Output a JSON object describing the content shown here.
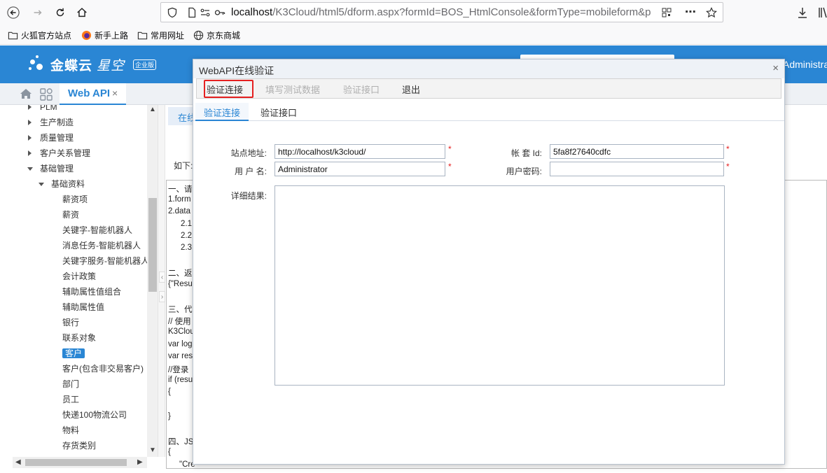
{
  "browser": {
    "url_host": "localhost",
    "url_rest": "/K3Cloud/html5/dform.aspx?formId=BOS_HtmlConsole&formType=mobileform&p",
    "bookmarks": [
      "火狐官方站点",
      "新手上路",
      "常用网址",
      "京东商城"
    ]
  },
  "app": {
    "logo_text": "金蝶云",
    "logo_text2": "星空",
    "logo_badge": "企业版",
    "user": "Administra"
  },
  "tabs": {
    "active": "Web API",
    "close": "×"
  },
  "tree": {
    "items": [
      {
        "label": "PLM",
        "level": 1,
        "arrow": "right"
      },
      {
        "label": "生产制造",
        "level": 1,
        "arrow": "right"
      },
      {
        "label": "质量管理",
        "level": 1,
        "arrow": "right"
      },
      {
        "label": "客户关系管理",
        "level": 1,
        "arrow": "right"
      },
      {
        "label": "基础管理",
        "level": 1,
        "arrow": "down"
      },
      {
        "label": "基础资料",
        "level": 2,
        "arrow": "down"
      },
      {
        "label": "薪资项",
        "level": 3
      },
      {
        "label": "薪资",
        "level": 3
      },
      {
        "label": "关键字-智能机器人",
        "level": 3
      },
      {
        "label": "消息任务-智能机器人",
        "level": 3
      },
      {
        "label": "关键字服务-智能机器人",
        "level": 3
      },
      {
        "label": "会计政策",
        "level": 3
      },
      {
        "label": "辅助属性值组合",
        "level": 3
      },
      {
        "label": "辅助属性值",
        "level": 3
      },
      {
        "label": "银行",
        "level": 3
      },
      {
        "label": "联系对象",
        "level": 3
      },
      {
        "label": "客户",
        "level": 3,
        "selected": true
      },
      {
        "label": "客户(包含非交易客户)",
        "level": 3
      },
      {
        "label": "部门",
        "level": 3
      },
      {
        "label": "员工",
        "level": 3
      },
      {
        "label": "快递100物流公司",
        "level": 3
      },
      {
        "label": "物料",
        "level": 3
      },
      {
        "label": "存货类别",
        "level": 3
      }
    ]
  },
  "doc": {
    "tab_label": "在线",
    "intro": "如下:",
    "lines": [
      "一、请",
      "1.form",
      "2.data",
      "2.1",
      "2.2",
      "2.3",
      "",
      "二、返",
      "{\"Resu",
      "",
      "三、代",
      "// 使用",
      "K3Clou",
      "var log",
      "var res",
      "//登录",
      "if (resu",
      "{",
      "",
      "}",
      "",
      "四、JS",
      "{",
      "\"Cre"
    ]
  },
  "dialog": {
    "title": "WebAPI在线验证",
    "close": "×",
    "toolbar": {
      "verify_connection": "验证连接",
      "fill_test_data": "填写测试数据",
      "verify_interface": "验证接口",
      "exit": "退出"
    },
    "tabs": [
      "验证连接",
      "验证接口"
    ],
    "form": {
      "site_label": "站点地址:",
      "site_value": "http://localhost/k3cloud/",
      "account_label": "帐 套 Id:",
      "account_value": "5fa8f27640cdfc",
      "user_label": "用 户 名:",
      "user_value": "Administrator",
      "password_label": "用户密码:",
      "password_value": "",
      "result_label": "详细结果:",
      "result_value": "",
      "required_mark": "*"
    }
  }
}
